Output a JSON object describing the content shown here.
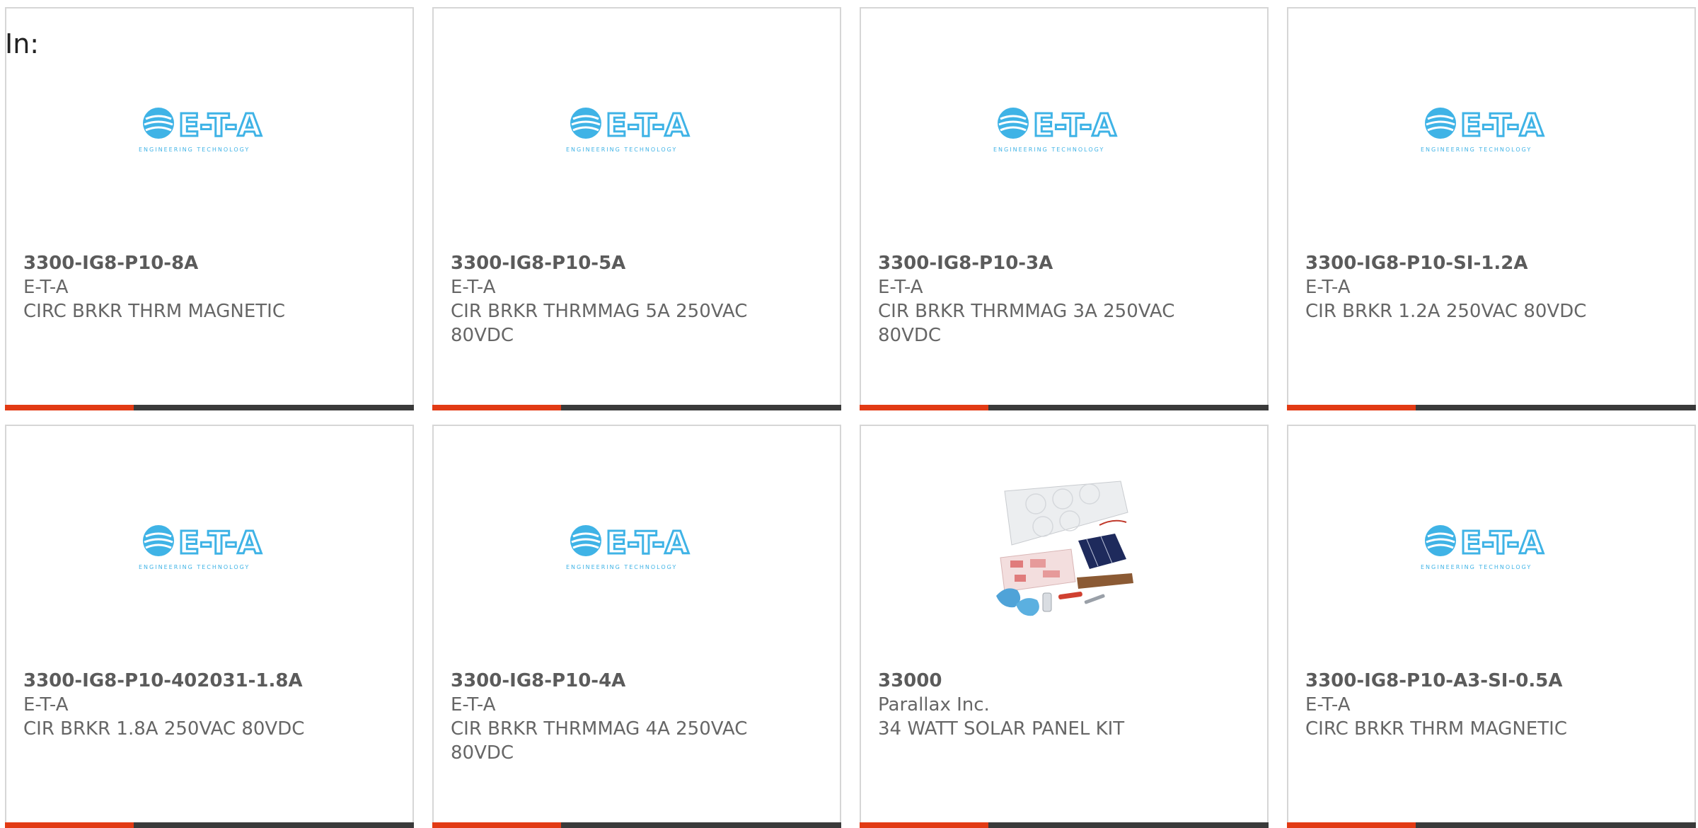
{
  "page_label": "In:",
  "brand_colors": {
    "accent_red": "#e23a14",
    "accent_dark": "#3a3a3a",
    "eta_blue": "#3fb3e6"
  },
  "logo": {
    "text": "E-T-A",
    "tagline": "ENGINEERING TECHNOLOGY"
  },
  "products": [
    {
      "part_number": "3300-IG8-P10-8A",
      "manufacturer": "E-T-A",
      "description": "CIRC BRKR THRM MAGNETIC",
      "image": "eta-logo"
    },
    {
      "part_number": "3300-IG8-P10-5A",
      "manufacturer": "E-T-A",
      "description": "CIR BRKR THRMMAG 5A 250VAC 80VDC",
      "image": "eta-logo"
    },
    {
      "part_number": "3300-IG8-P10-3A",
      "manufacturer": "E-T-A",
      "description": "CIR BRKR THRMMAG 3A 250VAC 80VDC",
      "image": "eta-logo"
    },
    {
      "part_number": "3300-IG8-P10-SI-1.2A",
      "manufacturer": "E-T-A",
      "description": "CIR BRKR 1.2A 250VAC 80VDC",
      "image": "eta-logo"
    },
    {
      "part_number": "3300-IG8-P10-402031-1.8A",
      "manufacturer": "E-T-A",
      "description": "CIR BRKR 1.8A 250VAC 80VDC",
      "image": "eta-logo"
    },
    {
      "part_number": "3300-IG8-P10-4A",
      "manufacturer": "E-T-A",
      "description": "CIR BRKR THRMMAG 4A 250VAC 80VDC",
      "image": "eta-logo"
    },
    {
      "part_number": "33000",
      "manufacturer": "Parallax Inc.",
      "description": "34 WATT SOLAR PANEL KIT",
      "image": "solar-panel-kit"
    },
    {
      "part_number": "3300-IG8-P10-A3-SI-0.5A",
      "manufacturer": "E-T-A",
      "description": "CIRC BRKR THRM MAGNETIC",
      "image": "eta-logo"
    }
  ]
}
